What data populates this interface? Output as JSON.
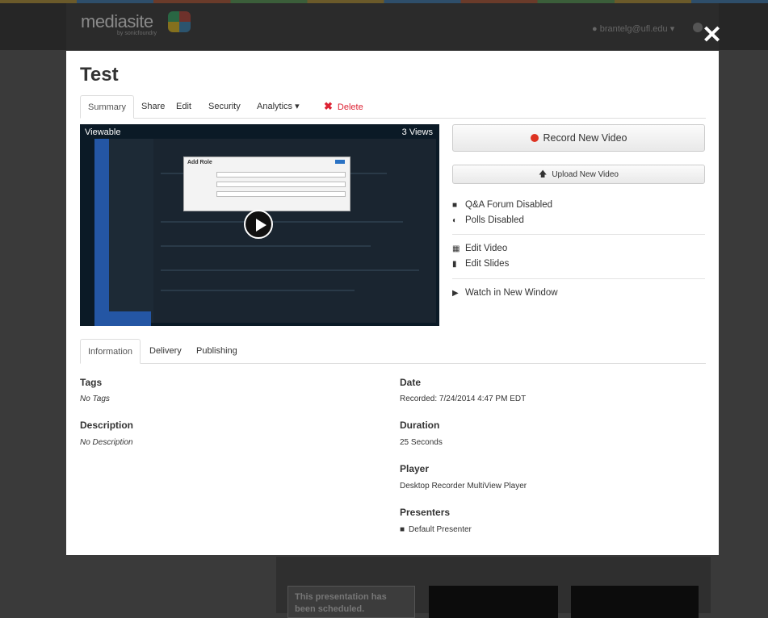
{
  "background": {
    "logo_text": "mediasite",
    "logo_sub": "by sonicfoundry",
    "user_menu": "brantelg@ufl.edu ▾",
    "scheduled_text": "This presentation has been scheduled."
  },
  "modal": {
    "title": "Test",
    "tabs": [
      {
        "label": "Summary"
      },
      {
        "label": "Share"
      },
      {
        "label": "Edit"
      },
      {
        "label": "Security"
      },
      {
        "label": "Analytics ▾"
      },
      {
        "label": "Delete"
      }
    ],
    "video": {
      "status": "Viewable",
      "views": "3 Views",
      "dialog_title": "Add Role"
    },
    "actions": {
      "record": "Record New Video",
      "upload": "Upload New Video"
    },
    "options": {
      "qa_forum": "Q&A Forum Disabled",
      "polls": "Polls Disabled",
      "edit_video": "Edit Video",
      "edit_slides": "Edit Slides",
      "watch": "Watch in New Window"
    },
    "info_tabs": [
      {
        "label": "Information"
      },
      {
        "label": "Delivery"
      },
      {
        "label": "Publishing"
      }
    ],
    "info": {
      "tags_label": "Tags",
      "tags_value": "No Tags",
      "description_label": "Description",
      "description_value": "No Description",
      "date_label": "Date",
      "date_value": "Recorded: 7/24/2014 4:47 PM EDT",
      "duration_label": "Duration",
      "duration_value": "25 Seconds",
      "player_label": "Player",
      "player_value": "Desktop Recorder MultiView Player",
      "presenters_label": "Presenters",
      "presenter_value": "Default Presenter"
    }
  }
}
